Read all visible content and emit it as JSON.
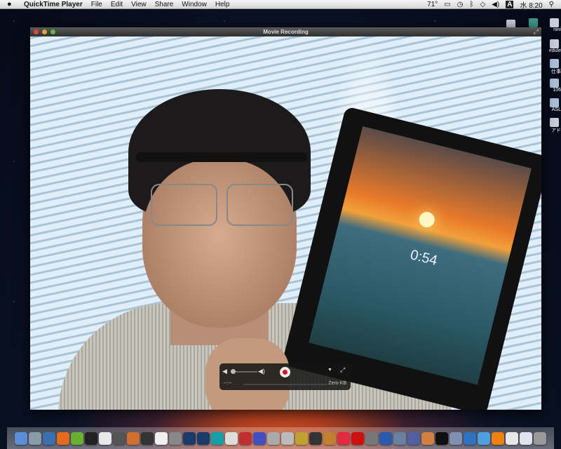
{
  "menubar": {
    "app": "QuickTime Player",
    "items": [
      "File",
      "Edit",
      "View",
      "Share",
      "Window",
      "Help"
    ],
    "status": {
      "temperature": "71°",
      "input": "A",
      "day": "水",
      "time": "8:20"
    }
  },
  "window": {
    "title": "Movie Recording"
  },
  "video": {
    "tablet_clock": "0:54"
  },
  "controls": {
    "elapsed": "--:--",
    "size": "Zero KB",
    "volume": 0.1
  },
  "desktop": {
    "items": [
      "nini",
      "edule",
      "仕事",
      "106",
      "ASL",
      "アド"
    ]
  },
  "dock": {
    "icons": [
      {
        "name": "finder",
        "color": "#5a8fd8"
      },
      {
        "name": "preview",
        "color": "#8a9aa8"
      },
      {
        "name": "thunderbird",
        "color": "#3c6fb0"
      },
      {
        "name": "firefox",
        "color": "#e56a1e"
      },
      {
        "name": "app-green",
        "color": "#6ab030"
      },
      {
        "name": "terminal",
        "color": "#222222"
      },
      {
        "name": "vnc",
        "color": "#e8e8e8"
      },
      {
        "name": "app-7",
        "color": "#555555"
      },
      {
        "name": "app-ring",
        "color": "#d07030"
      },
      {
        "name": "app-5",
        "color": "#333333"
      },
      {
        "name": "pd",
        "color": "#f0f0f0"
      },
      {
        "name": "app-box",
        "color": "#888888"
      },
      {
        "name": "processing",
        "color": "#1a3a6a"
      },
      {
        "name": "processing-2",
        "color": "#1a3a6a"
      },
      {
        "name": "arduino",
        "color": "#15a0a8"
      },
      {
        "name": "app-wind",
        "color": "#dddddd"
      },
      {
        "name": "app-dice",
        "color": "#c03030"
      },
      {
        "name": "app-blue",
        "color": "#4050c0"
      },
      {
        "name": "app-doc",
        "color": "#aaaaaa"
      },
      {
        "name": "app-grid",
        "color": "#bbbbbb"
      },
      {
        "name": "app-disk",
        "color": "#c0a030"
      },
      {
        "name": "piano",
        "color": "#333333"
      },
      {
        "name": "garageband",
        "color": "#c08030"
      },
      {
        "name": "itunes",
        "color": "#e02a40"
      },
      {
        "name": "flash",
        "color": "#cc1010"
      },
      {
        "name": "app-gray",
        "color": "#777777"
      },
      {
        "name": "app-home",
        "color": "#2a5ab0"
      },
      {
        "name": "app-photo",
        "color": "#6a80a0"
      },
      {
        "name": "app-pen",
        "color": "#5060a0"
      },
      {
        "name": "app-lamp",
        "color": "#d08040"
      },
      {
        "name": "activity-monitor",
        "color": "#101010"
      },
      {
        "name": "app-apr",
        "color": "#8090b0"
      },
      {
        "name": "quicktime",
        "color": "#3070c0"
      },
      {
        "name": "app-q",
        "color": "#50a0e0"
      },
      {
        "name": "vlc",
        "color": "#f08010"
      },
      {
        "name": "doc-1",
        "color": "#e8e8e8"
      },
      {
        "name": "doc-2",
        "color": "#dde4ec"
      },
      {
        "name": "trash",
        "color": "#999999"
      }
    ]
  }
}
